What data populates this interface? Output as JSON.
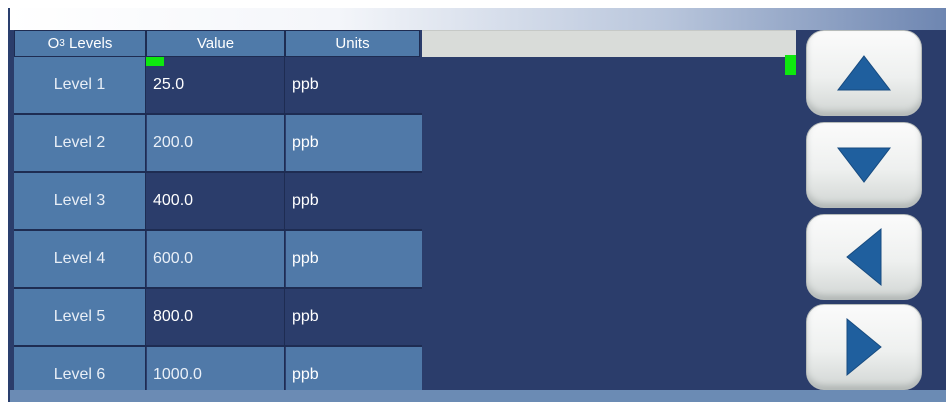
{
  "table": {
    "headers": {
      "levels_prefix": "O",
      "levels_subscript": "3",
      "levels_suffix": " Levels",
      "value": "Value",
      "units": "Units"
    },
    "rows": [
      {
        "label": "Level 1",
        "value": "25.0",
        "units": "ppb"
      },
      {
        "label": "Level 2",
        "value": "200.0",
        "units": "ppb"
      },
      {
        "label": "Level 3",
        "value": "400.0",
        "units": "ppb"
      },
      {
        "label": "Level 4",
        "value": "600.0",
        "units": "ppb"
      },
      {
        "label": "Level 5",
        "value": "800.0",
        "units": "ppb"
      },
      {
        "label": "Level 6",
        "value": "1000.0",
        "units": "ppb"
      }
    ]
  },
  "navigation": {
    "up_icon": "triangle-up-icon",
    "down_icon": "triangle-down-icon",
    "left_icon": "triangle-left-icon",
    "right_icon": "triangle-right-icon"
  },
  "colors": {
    "panel": "#2b3d6b",
    "cell_light": "#4f7aa9",
    "indicator": "#0ee80e",
    "arrow": "#1f5f9e"
  }
}
